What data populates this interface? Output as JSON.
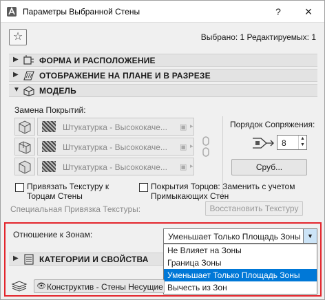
{
  "window": {
    "title": "Параметры Выбранной Стены",
    "help": "?",
    "close": "×"
  },
  "header": {
    "favorite_glyph": "☆",
    "selected_info": "Выбрано: 1 Редактируемых: 1"
  },
  "sections": {
    "shape": "ФОРМА И РАСПОЛОЖЕНИЕ",
    "plan": "ОТОБРАЖЕНИЕ НА ПЛАНЕ И В РАЗРЕЗЕ",
    "model": "МОДЕЛЬ",
    "categories": "КАТЕГОРИИ И СВОЙСТВА"
  },
  "model": {
    "override_label": "Замена Покрытий:",
    "surfaces": [
      "Штукатурка - Высококаче...",
      "Штукатурка - Высококаче...",
      "Штукатурка - Высококаче..."
    ],
    "join_order_label": "Порядок Сопряжения:",
    "join_order_value": "8",
    "spin_up": "▲",
    "spin_down": "▼",
    "pick_button": "Сруб...",
    "attach_texture_label": "Привязать Текстуру к Торцам Стены",
    "edge_surfaces_label": "Покрытия Торцов: Заменить с учетом Примыкающих Стен",
    "special_texture_label": "Специальная Привязка Текстуры:",
    "restore_texture_button": "Восстановить Текстуру",
    "picture_glyph": "▣",
    "menu_arrow_glyph": "▸"
  },
  "zones": {
    "relation_label": "Отношение к Зонам:",
    "selected": "Уменьшает Только Площадь Зоны",
    "options": [
      "Не Влияет на Зоны",
      "Граница Зоны",
      "Уменьшает Только Площадь Зоны",
      "Вычесть из Зон"
    ],
    "selected_index": 2
  },
  "footer": {
    "layer_name": "Конструктив - Стены Несущие",
    "eye_glyph": "👁"
  },
  "colors": {
    "highlight_border": "#e3242b",
    "selection": "#0078d7"
  }
}
